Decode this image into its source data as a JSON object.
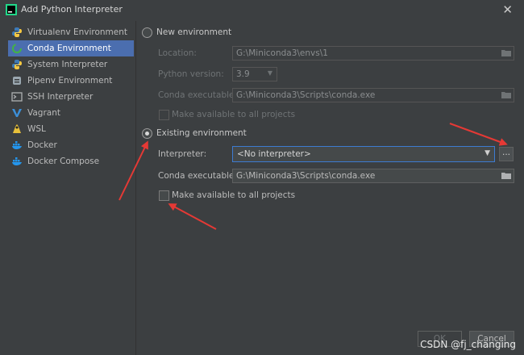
{
  "window": {
    "title": "Add Python Interpreter"
  },
  "sidebar": {
    "items": [
      {
        "label": "Virtualenv Environment",
        "icon": "python-icon"
      },
      {
        "label": "Conda Environment",
        "icon": "conda-icon",
        "active": true
      },
      {
        "label": "System Interpreter",
        "icon": "python-icon"
      },
      {
        "label": "Pipenv Environment",
        "icon": "pipenv-icon"
      },
      {
        "label": "SSH Interpreter",
        "icon": "ssh-icon"
      },
      {
        "label": "Vagrant",
        "icon": "vagrant-icon"
      },
      {
        "label": "WSL",
        "icon": "wsl-icon"
      },
      {
        "label": "Docker",
        "icon": "docker-icon"
      },
      {
        "label": "Docker Compose",
        "icon": "docker-icon"
      }
    ]
  },
  "new_env": {
    "radio_label": "New environment",
    "location_label": "Location:",
    "location_value": "G:\\Miniconda3\\envs\\1",
    "python_version_label": "Python version:",
    "python_version_value": "3.9",
    "conda_exec_label": "Conda executable:",
    "conda_exec_value": "G:\\Miniconda3\\Scripts\\conda.exe",
    "make_available_label": "Make available to all projects"
  },
  "existing_env": {
    "radio_label": "Existing environment",
    "interpreter_label": "Interpreter:",
    "interpreter_value": "<No interpreter>",
    "browse_label": "...",
    "conda_exec_label": "Conda executable:",
    "conda_exec_value": "G:\\Miniconda3\\Scripts\\conda.exe",
    "make_available_label": "Make available to all projects"
  },
  "buttons": {
    "ok": "OK",
    "cancel": "Cancel"
  },
  "watermark": "CSDN @fj_changing",
  "colors": {
    "accent": "#4b6eaf",
    "focus_border": "#3d7bd1",
    "annotation_arrow": "#e53935",
    "background": "#3c3f41"
  }
}
